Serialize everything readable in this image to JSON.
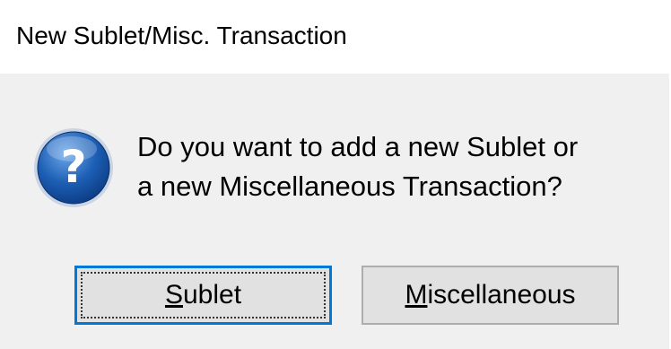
{
  "window": {
    "title": "New Sublet/Misc. Transaction"
  },
  "message": {
    "line1": "Do you want to add a new Sublet or",
    "line2": "a new Miscellaneous Transaction?",
    "icon": "question-icon"
  },
  "buttons": {
    "sublet": {
      "mnemonic": "S",
      "rest": "ublet"
    },
    "miscellaneous": {
      "mnemonic": "M",
      "rest": "iscellaneous"
    }
  },
  "colors": {
    "focus_border": "#0078d7",
    "icon_blue": "#1d5fb5",
    "dialog_background": "#f0f0f0"
  }
}
